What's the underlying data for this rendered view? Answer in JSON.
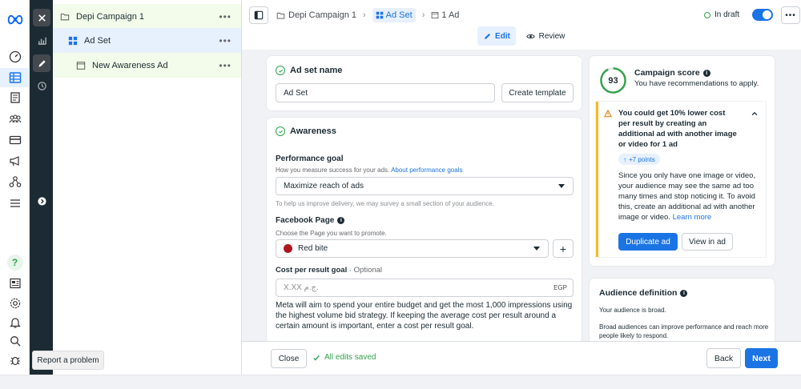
{
  "breadcrumb": {
    "campaign": "Depi Campaign 1",
    "adset": "Ad Set",
    "ad": "1 Ad"
  },
  "status": {
    "label": "In draft",
    "toggle_on": true
  },
  "mode_tabs": {
    "edit": "Edit",
    "review": "Review"
  },
  "tree": {
    "campaign": "Depi Campaign 1",
    "adset": "Ad Set",
    "ad": "New Awareness Ad",
    "more": "•••"
  },
  "adset_name": {
    "heading": "Ad set name",
    "value": "Ad Set",
    "create_template": "Create template"
  },
  "awareness": {
    "heading": "Awareness",
    "performance_goal_label": "Performance goal",
    "performance_goal_help": "How you measure success for your ads.",
    "performance_goal_link": "About performance goals",
    "performance_goal_value": "Maximize reach of ads",
    "survey_note": "To help us improve delivery, we may survey a small section of your audience.",
    "facebook_page_label": "Facebook Page",
    "facebook_page_help": "Choose the Page you want to promote.",
    "facebook_page_value": "Red bite",
    "cost_goal_label": "Cost per result goal",
    "cost_goal_optional": "· Optional",
    "cost_goal_placeholder": "X.XX ج.م.",
    "cost_goal_currency": "EGP",
    "cost_goal_desc": "Meta will aim to spend your entire budget and get the most 1,000 impressions using the highest volume bid strategy. If keeping the average cost per result around a certain amount is important, enter a cost per result goal."
  },
  "score": {
    "value": "93",
    "title": "Campaign score",
    "subtitle": "You have recommendations to apply.",
    "rec_title": "You could get 10% lower cost per result by creating an additional ad with another image or video for 1 ad",
    "points": "+7 points",
    "rec_body": "Since you only have one image or video, your audience may see the same ad too many times and stop noticing it. To avoid this, create an additional ad with another image or video.",
    "learn_more": "Learn more",
    "duplicate": "Duplicate ad",
    "view": "View in ad"
  },
  "audience": {
    "title": "Audience definition",
    "broad": "Your audience is broad.",
    "desc": "Broad audiences can improve performance and reach more people likely to respond."
  },
  "footer": {
    "close": "Close",
    "saved": "All edits saved",
    "back": "Back",
    "next": "Next"
  },
  "tooltip": "Report a problem",
  "help_glyph": "?",
  "colors": {
    "accent": "#1b74e4",
    "warning": "#f7b928",
    "success": "#31a24c",
    "dark_toolbar": "#1c2b33"
  }
}
